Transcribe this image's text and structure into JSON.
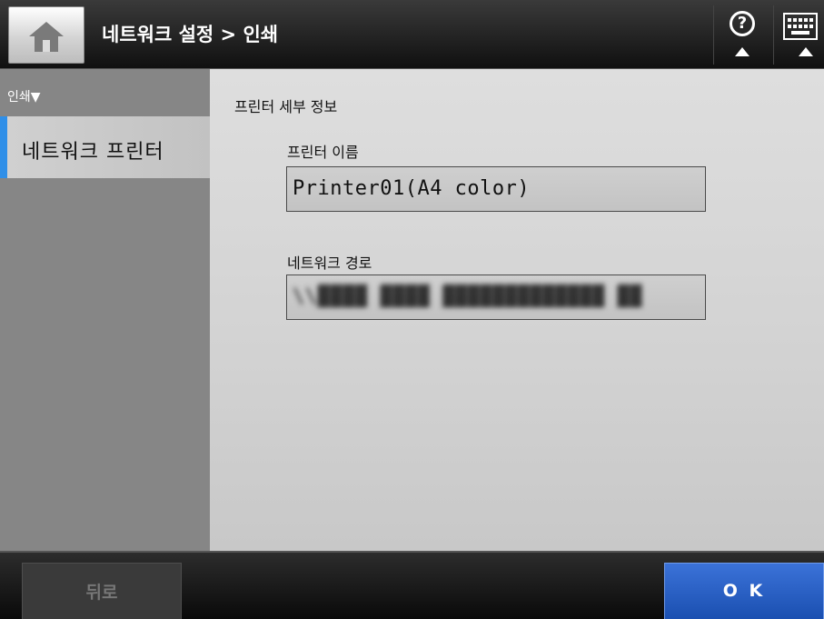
{
  "header": {
    "title": "네트워크 설정 > 인쇄",
    "home_icon": "home-icon",
    "help_icon": "help-icon",
    "keyboard_icon": "keyboard-icon"
  },
  "sidebar": {
    "section_label": "인쇄▼",
    "items": [
      {
        "label": "네트워크 프린터",
        "selected": true
      }
    ]
  },
  "main": {
    "section_title": "프린터 세부 정보",
    "printer_name_label": "프린터 이름",
    "printer_name_value": "Printer01(A4 color)",
    "network_path_label": "네트워크 경로"
  },
  "footer": {
    "back_label": "뒤로",
    "ok_label": "O K"
  },
  "colors": {
    "accent": "#2f8fe8",
    "ok_button": "#2a5fc4",
    "sidebar_bg": "#868686"
  }
}
